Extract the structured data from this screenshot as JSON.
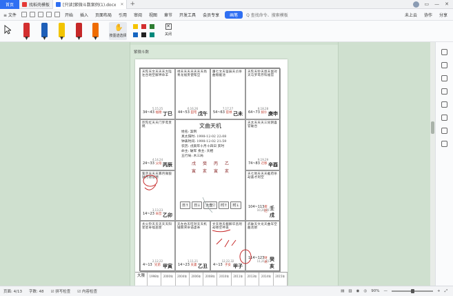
{
  "titlebar": {
    "home_tab": "首页",
    "tab1": "找稻壳模板",
    "tab2": "[只读]紫微斗数案例(1).docx",
    "new_tab": "+",
    "wps_ai": "",
    "right_icons": [
      "▭",
      "—",
      "✕"
    ]
  },
  "menubar": {
    "file": "≡ 文件",
    "items": [
      "开始",
      "插入",
      "页面布局",
      "引用",
      "审阅",
      "视图",
      "章节",
      "开发工具",
      "会员专享"
    ],
    "active": "画笔",
    "search_label": "Q 查找命令、搜索模板",
    "right": [
      "未上云",
      "协作",
      "分享"
    ]
  },
  "inkbar": {
    "lasso_label": "按墨迹选择",
    "close_label": "关闭",
    "pens": [
      {
        "color": "#d32f2f",
        "name": "red-pen"
      },
      {
        "color": "#1e5fb8",
        "name": "blue-pen"
      },
      {
        "color": "#f2c400",
        "name": "yellow-pen"
      },
      {
        "color": "#c62828",
        "name": "crimson-pen"
      },
      {
        "color": "#ef6c00",
        "name": "orange-pen"
      }
    ],
    "swatches": [
      "#f5c400",
      "#d32f2f",
      "#2e7d32",
      "#1565c0",
      "#212121",
      "#00897b"
    ]
  },
  "doc": {
    "caption": "紫微斗数",
    "center": {
      "title": "文曲天机",
      "lines": [
        "姓名: 案例",
        "真太阳时: 1998-12-02 22:08",
        "钟表时间: 1998-12-02 21:59",
        "农历: 戊寅年十月十四日 亥时",
        "命主: 破军  身主: 天相",
        "五行局: 木三局"
      ],
      "pillars": [
        "戊",
        "癸",
        "丙",
        "乙"
      ],
      "branches": [
        "寅",
        "亥",
        "寅",
        "亥"
      ],
      "buttons": [
        "日↑",
        "日↓",
        "大盘▽",
        "时↑",
        "时↓"
      ]
    },
    "cells": [
      {
        "stars": "天陀天文天天天大陰左台地空解神命羊",
        "age": "5,15,25",
        "palace": "福德",
        "range": "34~43",
        "stem": "丁巳"
      },
      {
        "stars": "禄天天天天天天天尚青龙福贵使帮旦",
        "age": "6,16,26",
        "palace": "田宅",
        "range": "44~53",
        "stem": "戊午"
      },
      {
        "stars": "廉七文天鉴辰天贞杀曲钺截池",
        "age": "7,17,27",
        "palace": "官禄",
        "range": "54~63",
        "stem": "己未"
      },
      {
        "stars": "天陀天铃天恩天副对天马罗鸾存科福官",
        "age": "8,18,28",
        "palace": "奴仆",
        "range": "64~73",
        "stem": "庚申"
      },
      {
        "stars": "巨陀红天天门罗鸾贵姚",
        "age": "4,14,24",
        "palace": "父母",
        "range": "24~33",
        "stem": "丙辰"
      },
      {
        "stars": "天太天天天三同阴喜官破台",
        "age": "9,19,29",
        "palace": "迁移",
        "range": "74~83",
        "stem": "辛酉"
      },
      {
        "stars": "紫贪天天天寡月微狼鉞月德宿德",
        "age": "3,13,23",
        "palace": "命宫",
        "range": "14~23",
        "stem": "乙卯"
      },
      {
        "stars": "天七地天天天截府杀劫喜才刑空",
        "age": "10,20,30",
        "palace": "疾厄",
        "range": "104~113",
        "stem": "壬戌"
      },
      {
        "stars": "太火铃天天天天天阳星星寿福巫使",
        "age": "2,12,22",
        "palace": "兄弟",
        "range": "4~13",
        "stem": "甲寅"
      },
      {
        "stars": "天左右天旺封天天机辅弼哭命诰虚寿",
        "age": "1,11,21",
        "palace": "夫妻",
        "range": "14~23",
        "stem": "乙丑"
      },
      {
        "stars": "文天地天截解华昌刑劫德空神盖",
        "age": "12,22,32",
        "palace": "子女",
        "range": "4~13",
        "stem": "甲子"
      },
      {
        "stars": "武破天文龙天曲军空曲池厨",
        "age": "11,21,31",
        "palace": "财帛",
        "range": "114~123",
        "stem": "癸亥"
      }
    ],
    "bottom": {
      "label": "大限",
      "cols": [
        "1998年",
        "2000年",
        "2004年",
        "2006年",
        "2008年",
        "2010年",
        "2011年",
        "2013年",
        "2014年",
        "2015年"
      ]
    }
  },
  "statusbar": {
    "page": "页面: 4/13",
    "words": "字数: 48",
    "spell": "拼写检查",
    "content": "内容检查",
    "zoom": "90%",
    "zoom_minus": "—",
    "zoom_plus": "+"
  }
}
